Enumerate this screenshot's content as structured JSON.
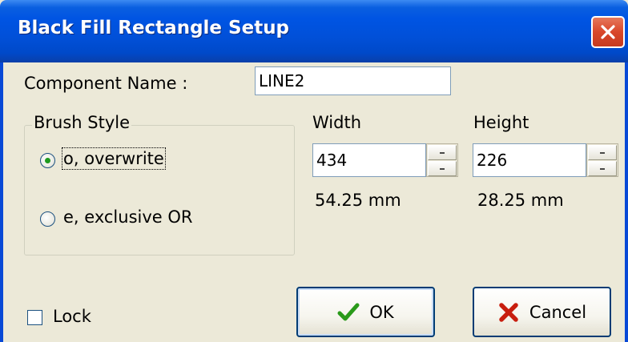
{
  "window": {
    "title": "Black Fill Rectangle Setup",
    "close_icon": "close-icon"
  },
  "component": {
    "label": "Component Name :",
    "value": "LINE2"
  },
  "brush_style": {
    "legend": "Brush Style",
    "options": [
      {
        "label": "o, overwrite",
        "selected": true
      },
      {
        "label": "e, exclusive OR",
        "selected": false
      }
    ]
  },
  "width": {
    "label": "Width",
    "value": "434",
    "mm": "54.25 mm"
  },
  "height": {
    "label": "Height",
    "value": "226",
    "mm": "28.25 mm"
  },
  "lock": {
    "label": "Lock",
    "checked": false
  },
  "buttons": {
    "ok_label": "OK",
    "ok_icon": "checkmark-icon",
    "cancel_label": "Cancel",
    "cancel_icon": "cross-icon"
  },
  "colors": {
    "titlebar": "#0054e3",
    "dialog_bg": "#ece9d8",
    "ok_check": "#2a9a1a",
    "cancel_cross": "#c81e0f"
  }
}
